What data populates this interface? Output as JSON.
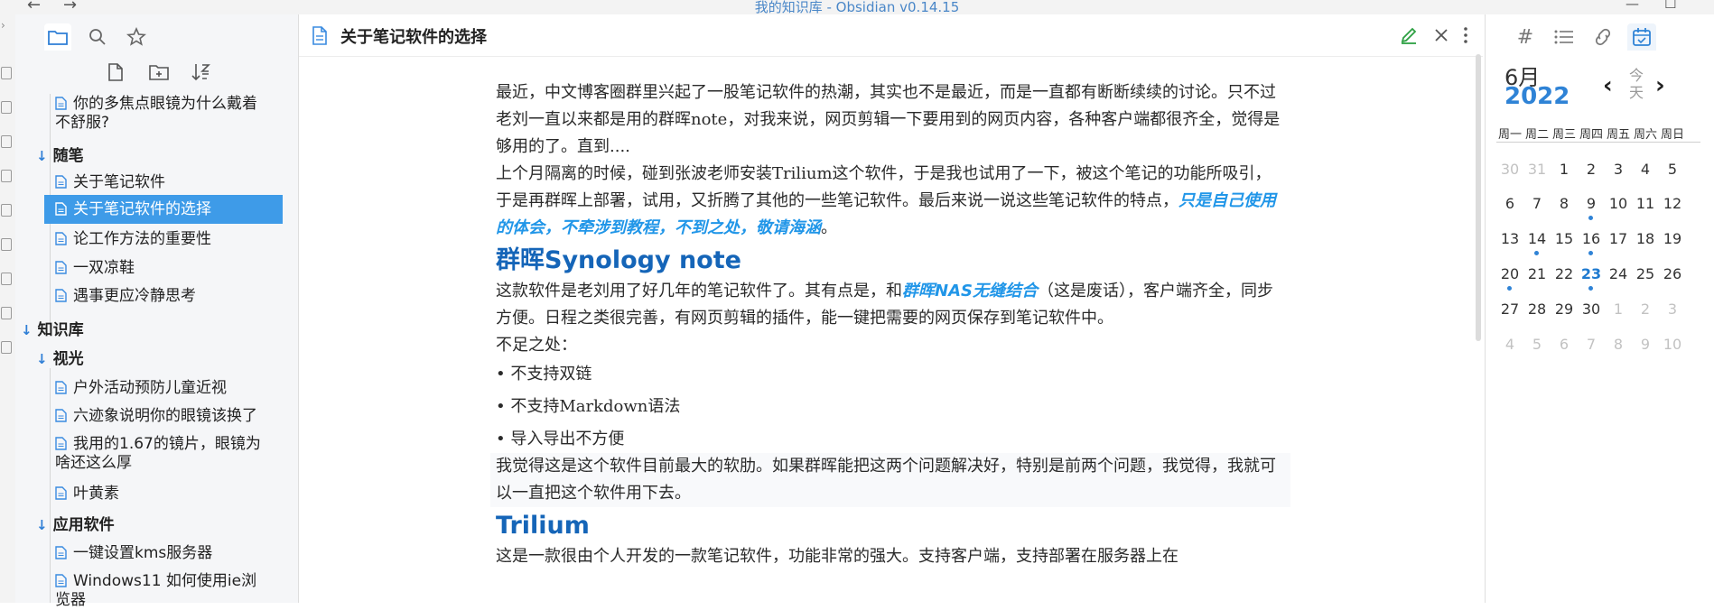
{
  "window": {
    "title": "我的知识库 - Obsidian v0.14.15",
    "controls": [
      "minimize-icon",
      "maximize-icon"
    ]
  },
  "left_panel": {
    "tabs": [
      {
        "icon": "folder-icon",
        "active": true
      },
      {
        "icon": "search-icon",
        "active": false
      },
      {
        "icon": "star-icon",
        "active": false
      }
    ],
    "actions": [
      "new-note-icon",
      "new-folder-icon",
      "sort-icon"
    ],
    "tree": [
      {
        "type": "file",
        "label": "你的多焦点眼镜为什么戴着不舒服?"
      },
      {
        "type": "folder",
        "label": "随笔"
      },
      {
        "type": "file",
        "label": "关于笔记软件"
      },
      {
        "type": "file",
        "label": "关于笔记软件的选择",
        "active": true
      },
      {
        "type": "file",
        "label": "论工作方法的重要性"
      },
      {
        "type": "file",
        "label": "一双凉鞋"
      },
      {
        "type": "file",
        "label": "遇事更应冷静思考"
      },
      {
        "type": "folder",
        "label": "知识库"
      },
      {
        "type": "folder",
        "label": "视光"
      },
      {
        "type": "file",
        "label": "户外活动预防儿童近视"
      },
      {
        "type": "file",
        "label": "六迹象说明你的眼镜该换了"
      },
      {
        "type": "file",
        "label": "我用的1.67的镜片，眼镜为啥还这么厚"
      },
      {
        "type": "file",
        "label": "叶黄素"
      },
      {
        "type": "folder",
        "label": "应用软件"
      },
      {
        "type": "file",
        "label": "一键设置kms服务器"
      },
      {
        "type": "file",
        "label": "Windows11 如何使用ie浏览器"
      }
    ]
  },
  "editor": {
    "title": "关于笔记软件的选择",
    "header_icons": [
      "edit-icon",
      "close-icon",
      "more-icon"
    ],
    "p1": "最近，中文博客圈群里兴起了一股笔记软件的热潮，其实也不是最近，而是一直都有断断续续的讨论。只不过老刘一直以来都是用的群晖note，对我来说，网页剪辑一下要用到的网页内容，各种客户端都很齐全，觉得是够用的了。直到....",
    "p2_text": "上个月隔离的时候，碰到张波老师安装Trilium这个软件，于是我也试用了一下，被这个笔记的功能所吸引，于是再群晖上部署，试用，又折腾了其他的一些笔记软件。最后来说一说这些笔记软件的特点，",
    "p2_highlight": "只是自己使用的体会，不牵涉到教程，不到之处，敬请海涵",
    "p2_end": "。",
    "h1": "群晖Synology note",
    "p3_text": "这款软件是老刘用了好几年的笔记软件了。其有点是，和",
    "p3_highlight": "群晖NAS无缝结合",
    "p3_end": "（这是废话），客户端齐全，同步方便。日程之类很完善，有网页剪辑的插件，能一键把需要的网页保存到笔记软件中。",
    "p4": "不足之处：",
    "bullets": [
      "不支持双链",
      "不支持Markdown语法",
      "导入导出不方便"
    ],
    "p5": "我觉得这是这个软件目前最大的软肋。如果群晖能把这两个问题解决好，特别是前两个问题，我觉得，我就可以一直把这个软件用下去。",
    "h2": "Trilium",
    "p6": "这是一款很由个人开发的一款笔记软件，功能非常的强大。支持客户端，支持部署在服务器上在"
  },
  "right_panel": {
    "tabs": [
      {
        "icon": "tag-icon",
        "active": false
      },
      {
        "icon": "outline-icon",
        "active": false
      },
      {
        "icon": "backlinks-icon",
        "active": false
      },
      {
        "icon": "calendar-icon",
        "active": true
      }
    ],
    "calendar": {
      "month": "6月",
      "year": "2022",
      "today_label": "今天",
      "weekdays": [
        "周一",
        "周二",
        "周三",
        "周四",
        "周五",
        "周六",
        "周日"
      ],
      "weeks": [
        [
          "30",
          "31",
          "1",
          "2",
          "3",
          "4",
          "5"
        ],
        [
          "6",
          "7",
          "8",
          "9",
          "10",
          "11",
          "12"
        ],
        [
          "13",
          "14",
          "15",
          "16",
          "17",
          "18",
          "19"
        ],
        [
          "20",
          "21",
          "22",
          "23",
          "24",
          "25",
          "26"
        ],
        [
          "27",
          "28",
          "29",
          "30",
          "1",
          "2",
          "3"
        ],
        [
          "4",
          "5",
          "6",
          "7",
          "8",
          "9",
          "10"
        ]
      ],
      "today": "23",
      "accent_color": "#2f83d6"
    }
  }
}
